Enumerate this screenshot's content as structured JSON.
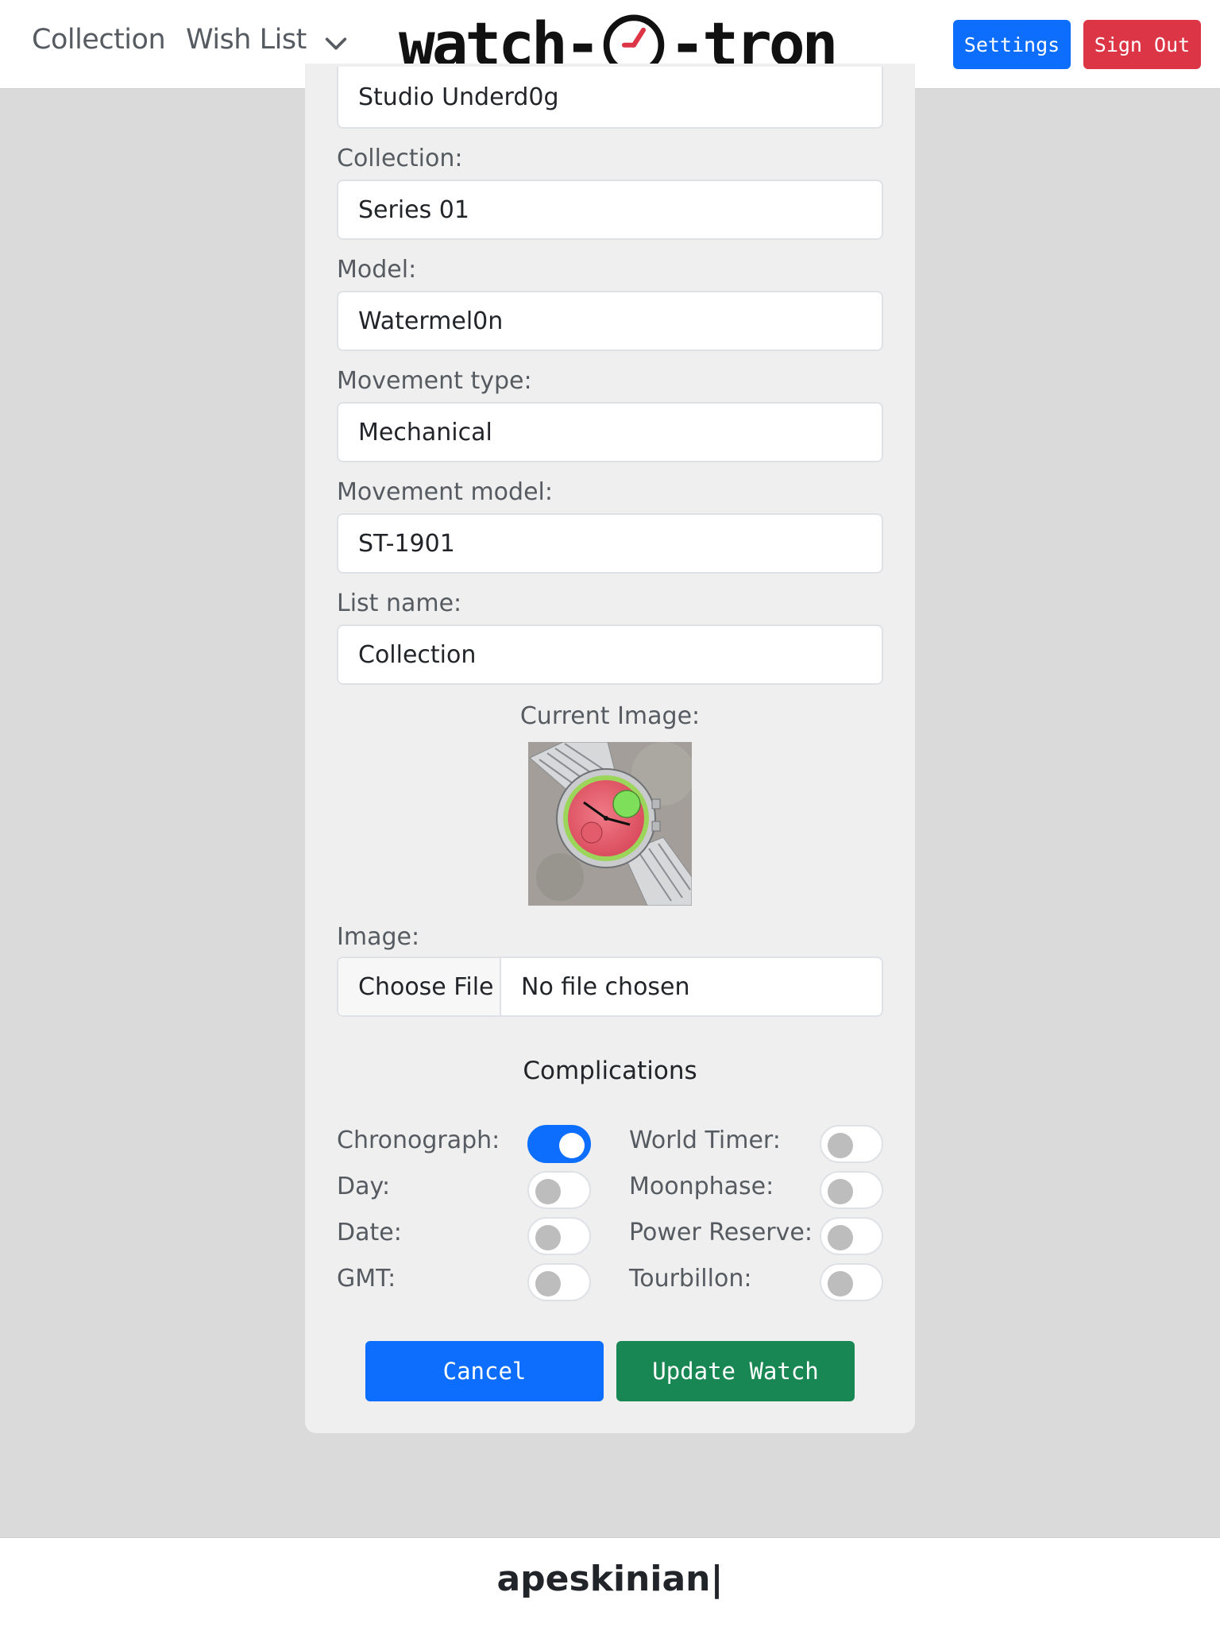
{
  "header": {
    "nav": {
      "collection_label": "Collection",
      "wishlist_label": "Wish List",
      "dropdown_icon": "chevron-down-icon"
    },
    "logo": {
      "text_left": "watch-",
      "text_right": "-tron",
      "clock_icon": "clock-icon",
      "clock_hand_color": "#dc3545"
    },
    "settings_label": "Settings",
    "signout_label": "Sign Out"
  },
  "form": {
    "brand_value": "Studio Underd0g",
    "collection": {
      "label": "Collection:",
      "value": "Series 01"
    },
    "model": {
      "label": "Model:",
      "value": "Watermel0n"
    },
    "movement_type": {
      "label": "Movement type:",
      "value": "Mechanical"
    },
    "movement_model": {
      "label": "Movement model:",
      "value": "ST-1901"
    },
    "list_name": {
      "label": "List name:",
      "value": "Collection"
    },
    "current_image_label": "Current Image:",
    "image": {
      "label": "Image:",
      "button": "Choose File",
      "status": "No file chosen"
    }
  },
  "complications": {
    "title": "Complications",
    "items": [
      {
        "label": "Chronograph:",
        "on": true
      },
      {
        "label": "World Timer:",
        "on": false
      },
      {
        "label": "Day:",
        "on": false
      },
      {
        "label": "Moonphase:",
        "on": false
      },
      {
        "label": "Date:",
        "on": false
      },
      {
        "label": "Power Reserve:",
        "on": false
      },
      {
        "label": "GMT:",
        "on": false
      },
      {
        "label": "Tourbillon:",
        "on": false
      }
    ]
  },
  "actions": {
    "cancel_label": "Cancel",
    "update_label": "Update Watch"
  },
  "colors": {
    "primary": "#0d6efd",
    "danger": "#dc3545",
    "success": "#198754"
  },
  "footer": {
    "username": "apeskinian|"
  }
}
